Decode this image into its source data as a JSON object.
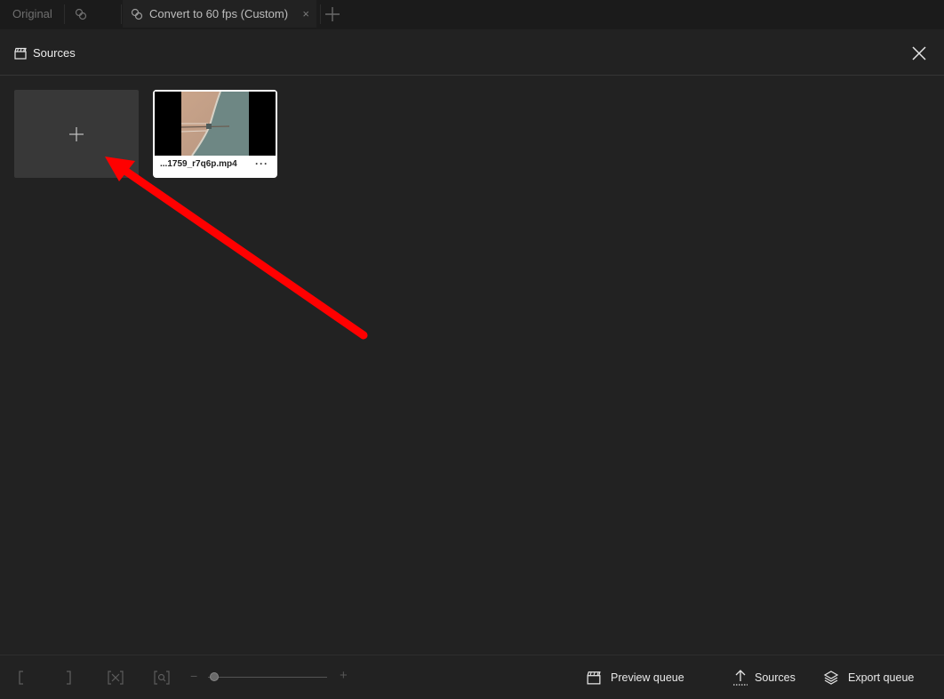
{
  "tabs": {
    "original": "Original",
    "active": "Convert to 60 fps (Custom)",
    "close_glyph": "×",
    "add_glyph": "+"
  },
  "panel": {
    "title": "Sources",
    "add_glyph": "+"
  },
  "media": [
    {
      "file_name": "...1759_r7q6p.mp4",
      "more_glyph": "···"
    }
  ],
  "toolbar": {
    "slider_min_glyph": "−",
    "slider_max_glyph": "+",
    "zoom_level": 0.05,
    "preview_queue_label": "Preview queue",
    "sources_label": "Sources",
    "export_queue_label": "Export queue"
  },
  "colors": {
    "background": "#222222",
    "annotation_arrow": "#ff0000",
    "card": "#ffffff"
  }
}
